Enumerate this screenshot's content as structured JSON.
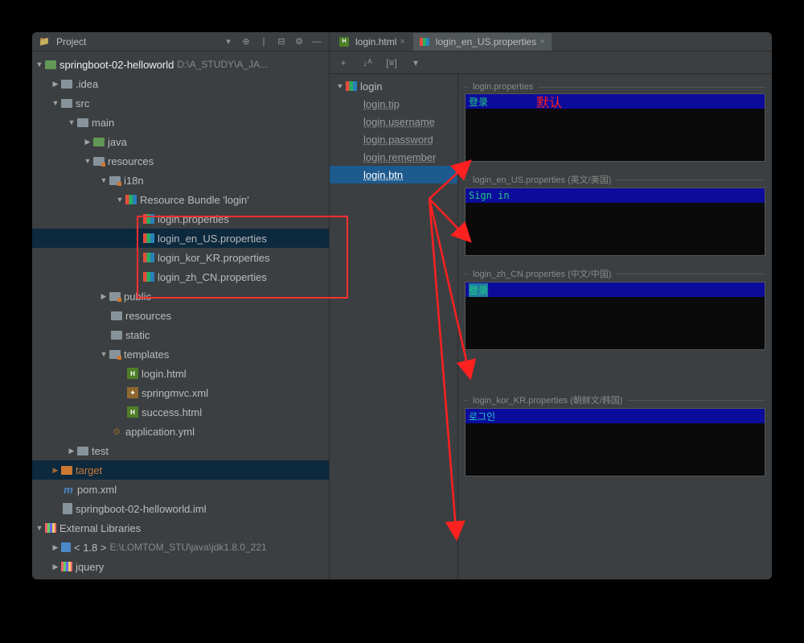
{
  "panel": {
    "title": "Project"
  },
  "project": {
    "name": "springboot-02-helloworld",
    "path": "D:\\A_STUDY\\A_JA..."
  },
  "tree": {
    "idea": ".idea",
    "src": "src",
    "main": "main",
    "java": "java",
    "resources": "resources",
    "i18n": "i18n",
    "bundle": "Resource Bundle 'login'",
    "login_props": "login.properties",
    "login_en": "login_en_US.properties",
    "login_kor": "login_kor_KR.properties",
    "login_zh": "login_zh_CN.properties",
    "public": "public",
    "resources2": "resources",
    "static": "static",
    "templates": "templates",
    "login_html": "login.html",
    "springmvc": "springmvc.xml",
    "success": "success.html",
    "appyml": "application.yml",
    "test": "test",
    "target": "target",
    "pom": "pom.xml",
    "iml": "springboot-02-helloworld.iml",
    "ext_lib": "External Libraries",
    "jdk_label": "< 1.8 >",
    "jdk_path": "E:\\LOMTOM_STU\\java\\jdk1.8.0_221",
    "jquery": "jquery"
  },
  "tabs": {
    "login_html": "login.html",
    "login_en": "login_en_US.properties"
  },
  "toolbar": {
    "add": "+",
    "sort": "↓ᴬ",
    "group": "[≡]",
    "dropdown": "▾"
  },
  "prop_tree": {
    "root": "login",
    "tip": "login.tip",
    "username": "login.username",
    "password": "login.password",
    "remember": "login.remember",
    "btn": "login.btn"
  },
  "editors": [
    {
      "title": "login.properties",
      "text_green": "登录",
      "text_red": "默认"
    },
    {
      "title": "login_en_US.properties (英文/美国)",
      "text_green": "Sign in"
    },
    {
      "title": "login_zh_CN.properties (中文/中国)",
      "text_green": "登录"
    },
    {
      "title": "login_kor_KR.properties (朝鲜文/韩国)",
      "text_green": "로그인"
    }
  ]
}
